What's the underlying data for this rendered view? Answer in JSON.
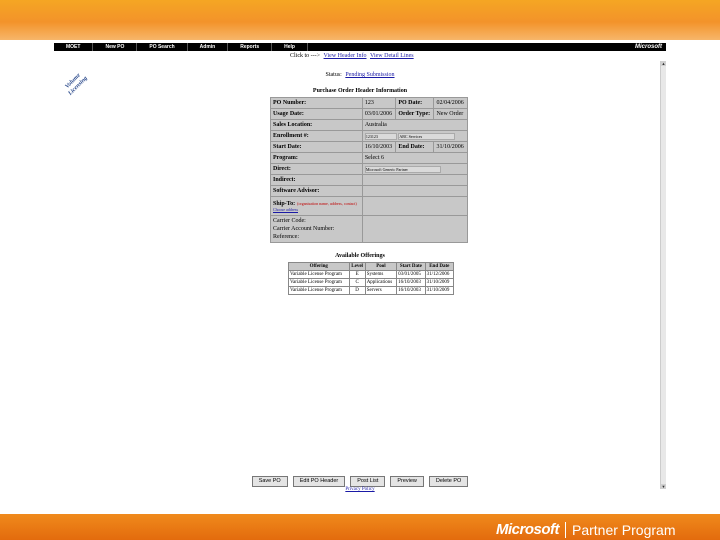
{
  "nav": {
    "items": [
      "MOET",
      "New PO",
      "PO Search",
      "Admin",
      "Reports",
      "Help"
    ],
    "logo": "Microsoft"
  },
  "badge": "Volume Licensing",
  "links": {
    "prefix": "Click to --->",
    "header_info": "View Header Info",
    "detail_lines": "View Detail Lines"
  },
  "status": {
    "label": "Status:",
    "value": "Pending Submission"
  },
  "header_title": "Purchase Order Header Information",
  "header": {
    "po_number_label": "PO Number:",
    "po_number": "123",
    "po_date_label": "PO Date:",
    "po_date": "02/04/2006",
    "usage_date_label": "Usage Date:",
    "usage_date": "03/01/2006",
    "order_type_label": "Order Type:",
    "order_type": "New Order",
    "sales_location_label": "Sales Location:",
    "sales_location": "Australia",
    "enrollment_label": "Enrollment #:",
    "enrollment_value": "123123",
    "enrollment_extra": "ABC Services",
    "start_date_label": "Start Date:",
    "start_date": "16/10/2003",
    "end_date_label": "End Date:",
    "end_date": "31/10/2006",
    "program_label": "Program:",
    "program": "Select 6",
    "direct_label": "Direct:",
    "direct_value": "Microsoft Generic Partner",
    "indirect_label": "Indirect:",
    "software_advisor_label": "Software Advisor:",
    "ship_to_label": "Ship-To:",
    "ship_to_value": "(organisation name, address, contact)",
    "choose_label": "Choose address",
    "carrier_code_label": "Carrier Code:",
    "carrier_account_label": "Carrier Account Number:",
    "reference_label": "Reference:"
  },
  "offerings": {
    "title": "Available Offerings",
    "columns": [
      "Offering",
      "Level",
      "Pool",
      "Start Date",
      "End Date"
    ],
    "rows": [
      [
        "Variable License Program",
        "E",
        "Systems",
        "03/01/2005",
        "31/12/2006"
      ],
      [
        "Variable License Program",
        "C",
        "Applications",
        "16/10/2003",
        "31/10/2009"
      ],
      [
        "Variable License Program",
        "D",
        "Servers",
        "16/10/2003",
        "31/10/2009"
      ]
    ]
  },
  "buttons": {
    "save": "Save PO",
    "edit": "Edit PO Header",
    "post": "Post List",
    "preview": "Preview",
    "delete": "Delete PO"
  },
  "privacy": "Privacy Policy",
  "brand": {
    "ms": "Microsoft",
    "pp": "Partner Program"
  }
}
